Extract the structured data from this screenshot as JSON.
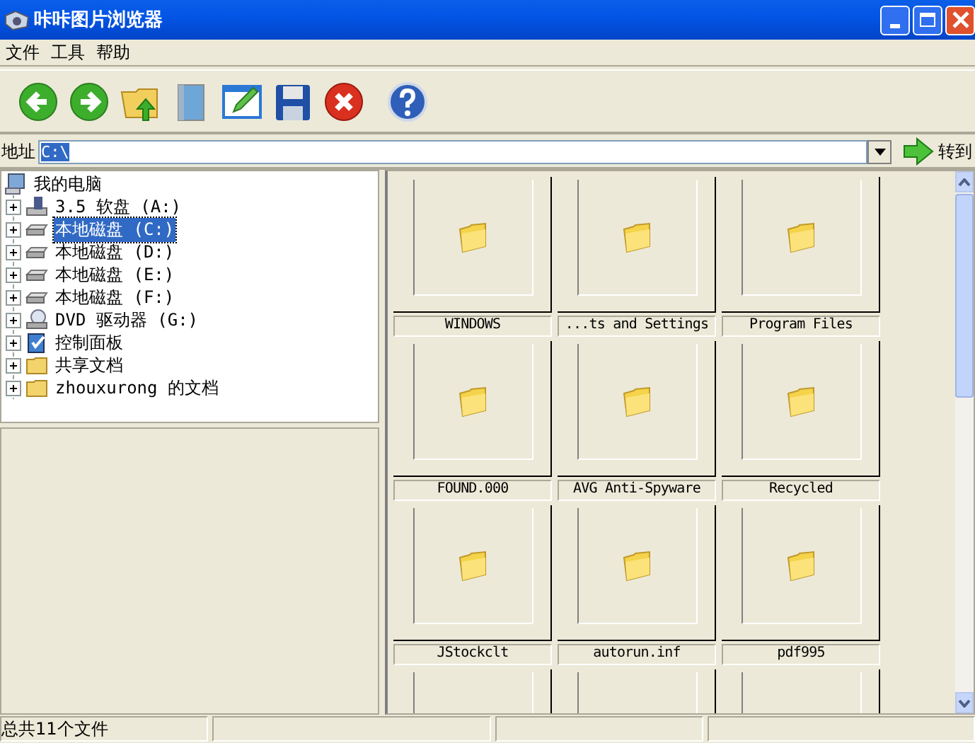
{
  "window": {
    "title": "咔咔图片浏览器"
  },
  "menu": [
    "文件",
    "工具",
    "帮助"
  ],
  "toolbar": [
    {
      "kind": "back"
    },
    {
      "kind": "forward"
    },
    {
      "kind": "up"
    },
    {
      "kind": "book"
    },
    {
      "kind": "edit"
    },
    {
      "kind": "save"
    },
    {
      "kind": "delete"
    },
    {
      "kind": "help"
    }
  ],
  "address": {
    "label": "地址",
    "value": "C:\\",
    "go": "转到"
  },
  "tree": {
    "label": "我的电脑",
    "kind": "computer",
    "children": [
      {
        "label": "3.5 软盘 (A:)",
        "kind": "floppy",
        "expanded": false,
        "selected": false
      },
      {
        "label": "本地磁盘 (C:)",
        "kind": "drive",
        "expanded": false,
        "selected": true
      },
      {
        "label": "本地磁盘 (D:)",
        "kind": "drive",
        "expanded": false,
        "selected": false
      },
      {
        "label": "本地磁盘 (E:)",
        "kind": "drive",
        "expanded": false,
        "selected": false
      },
      {
        "label": "本地磁盘 (F:)",
        "kind": "drive",
        "expanded": false,
        "selected": false
      },
      {
        "label": "DVD 驱动器 (G:)",
        "kind": "dvd",
        "expanded": false,
        "selected": false
      },
      {
        "label": "控制面板",
        "kind": "control",
        "expanded": false,
        "selected": false
      },
      {
        "label": "共享文档",
        "kind": "folder",
        "expanded": false,
        "selected": false
      },
      {
        "label": "zhouxurong 的文档",
        "kind": "folder",
        "expanded": false,
        "selected": false
      }
    ]
  },
  "thumbnails": [
    {
      "name": "WINDOWS",
      "kind": "folder"
    },
    {
      "name": "...ts and Settings",
      "kind": "folder"
    },
    {
      "name": "Program Files",
      "kind": "folder"
    },
    {
      "name": "FOUND.000",
      "kind": "folder"
    },
    {
      "name": "AVG Anti-Spyware",
      "kind": "folder"
    },
    {
      "name": "Recycled",
      "kind": "folder"
    },
    {
      "name": "JStockclt",
      "kind": "folder"
    },
    {
      "name": "autorun.inf",
      "kind": "folder"
    },
    {
      "name": "pdf995",
      "kind": "folder"
    },
    {
      "kind": "blank"
    },
    {
      "kind": "blank"
    },
    {
      "kind": "blank"
    }
  ],
  "status_bar": [
    "总共11个文件"
  ]
}
